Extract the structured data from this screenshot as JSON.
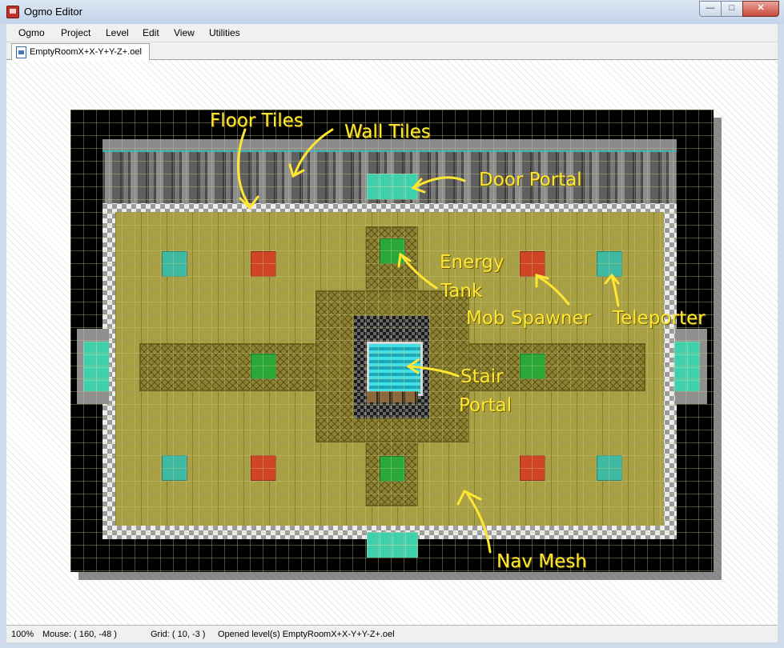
{
  "window": {
    "title": "Ogmo Editor",
    "buttons": {
      "minimize": "—",
      "maximize": "□",
      "close": "✕"
    }
  },
  "menu": {
    "items": [
      "Ogmo",
      "Project",
      "Level",
      "Edit",
      "View",
      "Utilities"
    ]
  },
  "tabs": [
    {
      "label": "EmptyRoomX+X-Y+Y-Z+.oel",
      "icon": "document-icon"
    }
  ],
  "annotations": {
    "floor_tiles": "Floor Tiles",
    "wall_tiles": "Wall Tiles",
    "door_portal": "Door Portal",
    "energy": "Energy",
    "tank": "Tank",
    "mob_spawner": "Mob Spawner",
    "teleporter": "Teleporter",
    "stair": "Stair",
    "portal": "Portal",
    "nav_mesh": "Nav Mesh"
  },
  "colors": {
    "annotation": "#ffe633",
    "teleporter": "#3fb9a2",
    "mob_spawner": "#cf4424",
    "energy_tank": "#2aa838",
    "floor": "#a8a043",
    "portal": "#3fcfaa"
  },
  "status": {
    "zoom": "100%",
    "mouse": "Mouse: ( 160, -48 )",
    "grid": "Grid: ( 10, -3 )",
    "message": "Opened level(s) EmptyRoomX+X-Y+Y-Z+.oel"
  }
}
